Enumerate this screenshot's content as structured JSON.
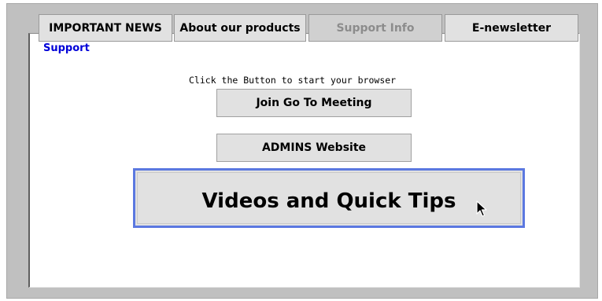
{
  "tabs": [
    {
      "label": "IMPORTANT NEWS",
      "selected": false
    },
    {
      "label": "About our products",
      "selected": false
    },
    {
      "label": "Support Info",
      "selected": true
    },
    {
      "label": "E-newsletter",
      "selected": false
    }
  ],
  "section_label": "Support",
  "instruction": "Click the Button to start your browser",
  "buttons": {
    "meeting": "Join Go To Meeting",
    "admins": "ADMINS Website",
    "videos": "Videos and Quick Tips"
  },
  "colors": {
    "link_blue": "#0000d8",
    "focus_border": "#5b78e0",
    "button_bg": "#e1e1e1",
    "window_bg": "#c0c0c0"
  },
  "icons": {
    "cursor": "arrow-cursor-icon"
  }
}
